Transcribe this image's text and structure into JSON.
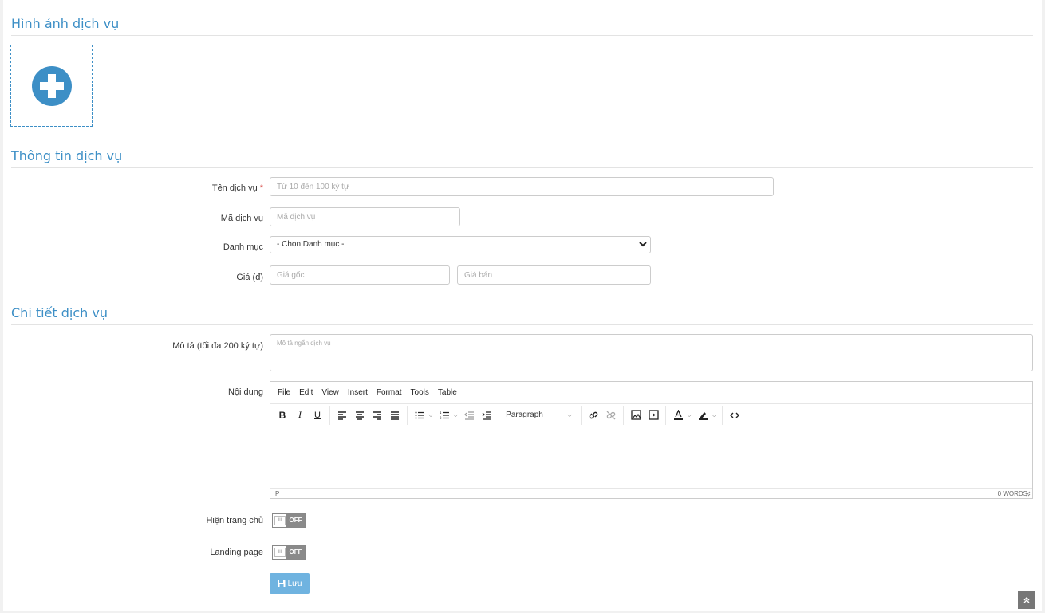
{
  "sections": {
    "image": "Hình ảnh dịch vụ",
    "info": "Thông tin dịch vụ",
    "detail": "Chi tiết dịch vụ"
  },
  "fields": {
    "name": {
      "label": "Tên dịch vụ",
      "required": "*",
      "placeholder": "Từ 10 đến 100 ký tự",
      "value": ""
    },
    "code": {
      "label": "Mã dịch vụ",
      "placeholder": "Mã dịch vụ",
      "value": ""
    },
    "category": {
      "label": "Danh mục",
      "selected": "- Chọn Danh mục -"
    },
    "price": {
      "label": "Giá (đ)",
      "original_placeholder": "Giá gốc",
      "sale_placeholder": "Giá bán"
    },
    "description": {
      "label": "Mô tả (tối đa 200 ký tự)",
      "placeholder": "Mô tả ngắn dịch vụ"
    },
    "content": {
      "label": "Nội dung"
    }
  },
  "editor": {
    "menu": [
      "File",
      "Edit",
      "View",
      "Insert",
      "Format",
      "Tools",
      "Table"
    ],
    "format_select": "Paragraph",
    "status_path": "P",
    "word_count": "0 WORDS"
  },
  "toggles": {
    "homepage": {
      "label": "Hiện trang chủ",
      "state": "OFF"
    },
    "landing": {
      "label": "Landing page",
      "state": "OFF"
    }
  },
  "save_label": "Lưu",
  "icons": {
    "add_image": "plus-circle-icon",
    "save": "floppy-icon",
    "scroll_top": "double-chevron-up-icon"
  },
  "colors": {
    "accent": "#3d8fc6",
    "save_button": "#6fb3e0",
    "required": "#d9534f"
  }
}
